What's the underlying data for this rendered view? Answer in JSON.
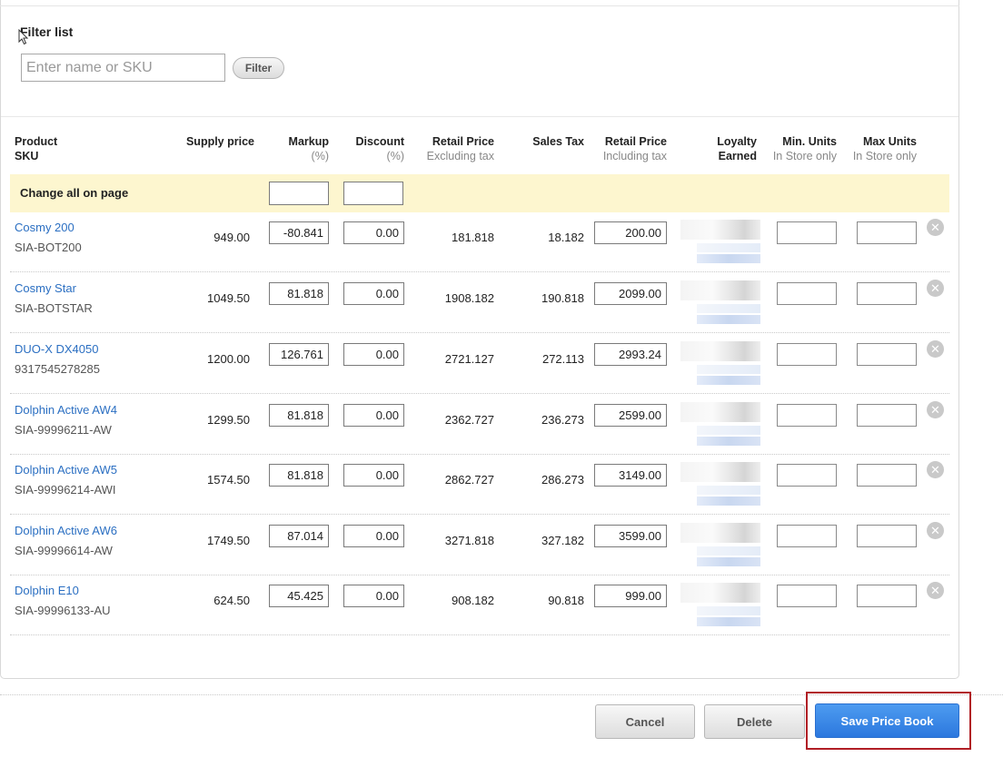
{
  "filter": {
    "title": "Filter list",
    "placeholder": "Enter name or SKU",
    "button": "Filter"
  },
  "headers": {
    "product": "Product",
    "sku": "SKU",
    "supply": "Supply price",
    "markup": "Markup",
    "markup_sub": "(%)",
    "discount": "Discount",
    "discount_sub": "(%)",
    "retail_ex": "Retail Price",
    "retail_ex_sub": "Excluding tax",
    "sales_tax": "Sales Tax",
    "retail_in": "Retail Price",
    "retail_in_sub": "Including tax",
    "loyalty": "Loyalty",
    "loyalty_sub": "Earned",
    "min_units": "Min. Units",
    "min_units_sub": "In Store only",
    "max_units": "Max Units",
    "max_units_sub": "In Store only"
  },
  "change_all": {
    "label": "Change all on page"
  },
  "rows": [
    {
      "name": "Cosmy 200",
      "sku": "SIA-BOT200",
      "supply": "949.00",
      "markup": "-80.841",
      "discount": "0.00",
      "retail_ex": "181.818",
      "tax": "18.182",
      "retail_in": "200.00"
    },
    {
      "name": "Cosmy Star",
      "sku": "SIA-BOTSTAR",
      "supply": "1049.50",
      "markup": "81.818",
      "discount": "0.00",
      "retail_ex": "1908.182",
      "tax": "190.818",
      "retail_in": "2099.00"
    },
    {
      "name": "DUO-X DX4050",
      "sku": "9317545278285",
      "supply": "1200.00",
      "markup": "126.761",
      "discount": "0.00",
      "retail_ex": "2721.127",
      "tax": "272.113",
      "retail_in": "2993.24"
    },
    {
      "name": "Dolphin Active AW4",
      "sku": "SIA-99996211-AW",
      "supply": "1299.50",
      "markup": "81.818",
      "discount": "0.00",
      "retail_ex": "2362.727",
      "tax": "236.273",
      "retail_in": "2599.00"
    },
    {
      "name": "Dolphin Active AW5",
      "sku": "SIA-99996214-AWI",
      "supply": "1574.50",
      "markup": "81.818",
      "discount": "0.00",
      "retail_ex": "2862.727",
      "tax": "286.273",
      "retail_in": "3149.00"
    },
    {
      "name": "Dolphin Active AW6",
      "sku": "SIA-99996614-AW",
      "supply": "1749.50",
      "markup": "87.014",
      "discount": "0.00",
      "retail_ex": "3271.818",
      "tax": "327.182",
      "retail_in": "3599.00"
    },
    {
      "name": "Dolphin E10",
      "sku": "SIA-99996133-AU",
      "supply": "624.50",
      "markup": "45.425",
      "discount": "0.00",
      "retail_ex": "908.182",
      "tax": "90.818",
      "retail_in": "999.00"
    }
  ],
  "actions": {
    "cancel": "Cancel",
    "delete": "Delete",
    "save": "Save Price Book"
  },
  "colors": {
    "link": "#2b6fc2",
    "highlight_row": "#fdf6cf",
    "primary": "#2c78de",
    "callout": "#b11e25"
  }
}
